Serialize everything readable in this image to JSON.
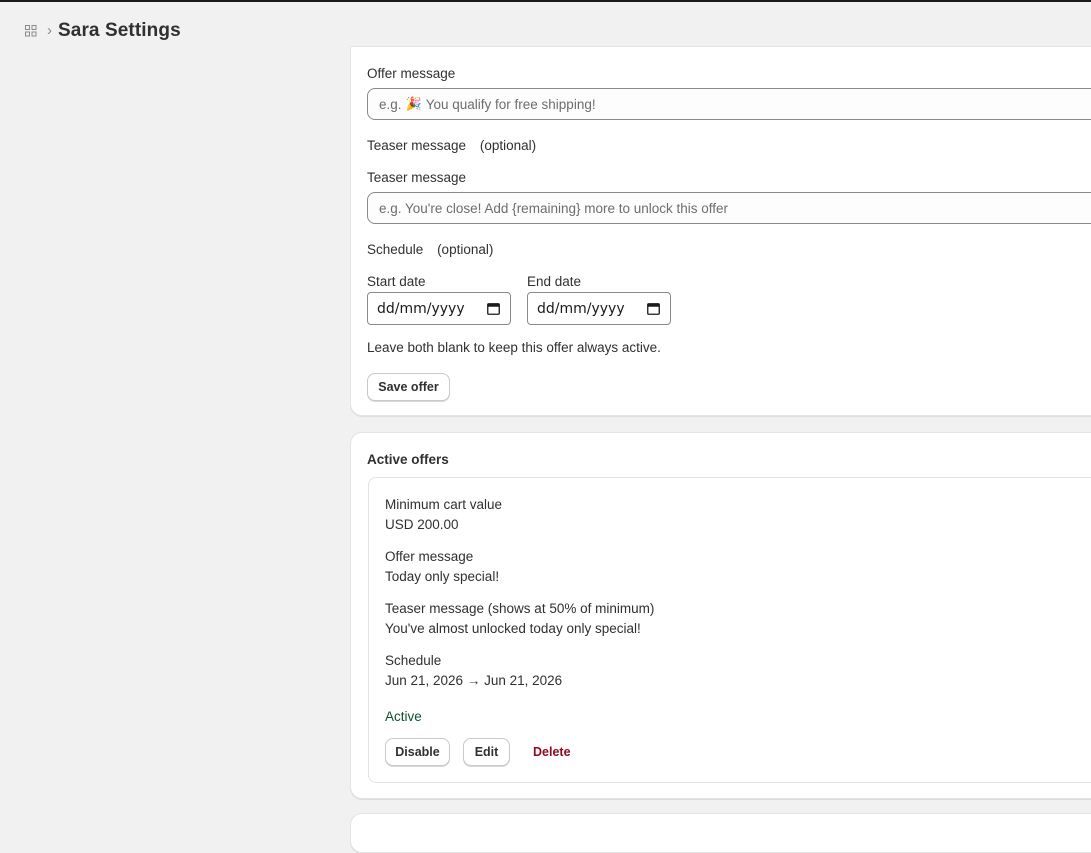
{
  "header": {
    "app_icon": "apps-grid-icon",
    "separator": "›",
    "title": "Sara Settings"
  },
  "offer_form": {
    "offer_message_label": "Offer message",
    "offer_message_placeholder_prefix": "e.g.",
    "offer_message_placeholder_emoji": "🎉",
    "offer_message_placeholder_text": "You qualify for free shipping!",
    "teaser_section_label": "Teaser message",
    "teaser_section_optional": "(optional)",
    "teaser_field_label": "Teaser message",
    "teaser_placeholder": "e.g. You're close! Add {remaining} more to unlock this offer",
    "schedule_label": "Schedule",
    "schedule_optional": "(optional)",
    "start_date_label": "Start date",
    "start_date_value": "dd/mm/yyyy",
    "end_date_label": "End date",
    "end_date_value": "dd/mm/yyyy",
    "help_text": "Leave both blank to keep this offer always active.",
    "save_button": "Save offer"
  },
  "active_offers": {
    "title": "Active offers",
    "offers": [
      {
        "min_cart_label": "Minimum cart value",
        "min_cart_value": "USD 200.00",
        "offer_message_label": "Offer message",
        "offer_message_value": "Today only special!",
        "teaser_label": "Teaser message (shows at 50% of minimum)",
        "teaser_value": "You've almost unlocked today only special!",
        "schedule_label": "Schedule",
        "schedule_value": "Jun 21, 2026 → Jun 21, 2026",
        "status": "Active",
        "disable_button": "Disable",
        "edit_button": "Edit",
        "delete_button": "Delete"
      }
    ]
  },
  "colors": {
    "background": "#f1f1f1",
    "card": "#ffffff",
    "status_active": "#0c5132",
    "danger": "#8e0b21"
  }
}
